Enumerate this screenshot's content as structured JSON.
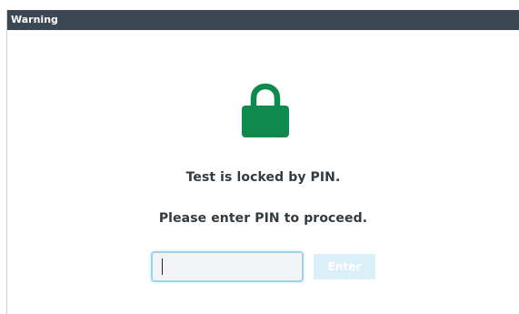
{
  "window": {
    "title": "Warning"
  },
  "lock_icon": {
    "name": "lock-icon",
    "color": "#0e8a4e"
  },
  "messages": {
    "locked": "Test is locked by PIN.",
    "prompt": "Please enter PIN to proceed."
  },
  "pin_field": {
    "value": "",
    "placeholder": ""
  },
  "enter_button": {
    "label": "Enter",
    "state": "disabled"
  }
}
